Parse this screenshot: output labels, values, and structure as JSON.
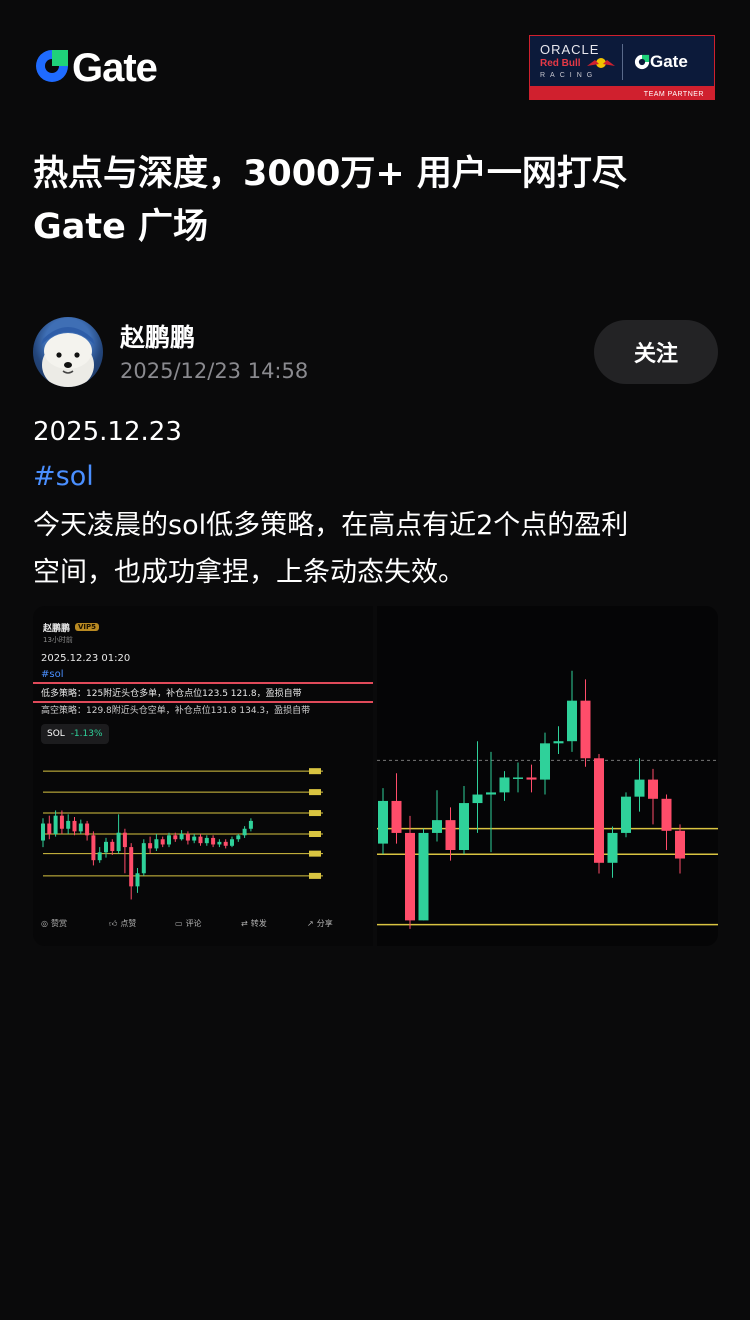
{
  "brand": {
    "name": "Gate",
    "logo_colors": {
      "blue": "#1f6bff",
      "green": "#1fd27a"
    }
  },
  "partner_badge": {
    "line1": "ORACLE",
    "line2": "Red Bull",
    "line3": "RACING",
    "brand": "Gate",
    "footer": "TEAM PARTNER"
  },
  "headline": {
    "line1": "热点与深度，3000万+ 用户一网打尽",
    "line2": "Gate 广场"
  },
  "author": {
    "name": "赵鹏鹏",
    "timestamp": "2025/12/23 14:58",
    "avatar_icon": "dog-avatar-icon"
  },
  "follow_label": "关注",
  "post": {
    "date": "2025.12.23",
    "tag": "#sol",
    "body_line1": "今天凌晨的sol低多策略，在高点有近2个点的盈利",
    "body_line2": "空间，也成功拿捏，上条动态失效。"
  },
  "image1": {
    "name": "赵鹏鹏",
    "vip": "VIP5",
    "ago": "13小时前",
    "date": "2025.12.23 01:20",
    "tag": "#sol",
    "long_line": "低多策略：125附近头仓多单，补仓点位123.5 121.8，盈损自带",
    "short_line": "高空策略：129.8附近头仓空单，补仓点位131.8 134.3，盈损自带",
    "sol_label": "SOL",
    "sol_change": "-1.13%",
    "actions": [
      "赞赏",
      "点赞",
      "评论",
      "转发",
      "分享"
    ]
  },
  "colors": {
    "background": "#0a0a0b",
    "tag_blue": "#4a8fff",
    "candle_up": "#2fd19a",
    "candle_down": "#ff4d6a",
    "level_line": "#d9c441"
  },
  "candles_small": [
    {
      "o": 124.5,
      "c": 125.8,
      "h": 126.2,
      "l": 124.0
    },
    {
      "o": 125.8,
      "c": 125.0,
      "h": 126.4,
      "l": 124.6
    },
    {
      "o": 125.0,
      "c": 126.4,
      "h": 126.8,
      "l": 124.8
    },
    {
      "o": 126.4,
      "c": 125.4,
      "h": 126.8,
      "l": 125.0
    },
    {
      "o": 125.4,
      "c": 126.0,
      "h": 126.5,
      "l": 125.0
    },
    {
      "o": 126.0,
      "c": 125.2,
      "h": 126.3,
      "l": 124.9
    },
    {
      "o": 125.2,
      "c": 125.8,
      "h": 126.1,
      "l": 125.0
    },
    {
      "o": 125.8,
      "c": 124.9,
      "h": 126.0,
      "l": 124.5
    },
    {
      "o": 124.9,
      "c": 123.0,
      "h": 125.2,
      "l": 122.6
    },
    {
      "o": 123.0,
      "c": 123.6,
      "h": 124.0,
      "l": 122.8
    },
    {
      "o": 123.6,
      "c": 124.4,
      "h": 124.7,
      "l": 123.2
    },
    {
      "o": 124.4,
      "c": 123.7,
      "h": 124.6,
      "l": 123.4
    },
    {
      "o": 123.7,
      "c": 125.1,
      "h": 126.5,
      "l": 123.5
    },
    {
      "o": 125.1,
      "c": 124.0,
      "h": 125.4,
      "l": 122.0
    },
    {
      "o": 124.0,
      "c": 121.0,
      "h": 124.3,
      "l": 120.0
    },
    {
      "o": 121.0,
      "c": 122.0,
      "h": 122.4,
      "l": 120.5
    },
    {
      "o": 122.0,
      "c": 124.3,
      "h": 124.6,
      "l": 121.8
    },
    {
      "o": 124.3,
      "c": 123.9,
      "h": 124.8,
      "l": 123.5
    },
    {
      "o": 123.9,
      "c": 124.6,
      "h": 125.0,
      "l": 123.7
    },
    {
      "o": 124.6,
      "c": 124.2,
      "h": 124.8,
      "l": 124.0
    },
    {
      "o": 124.2,
      "c": 124.9,
      "h": 125.1,
      "l": 124.0
    },
    {
      "o": 124.9,
      "c": 124.6,
      "h": 125.1,
      "l": 124.4
    },
    {
      "o": 124.6,
      "c": 125.0,
      "h": 125.3,
      "l": 124.5
    },
    {
      "o": 125.0,
      "c": 124.5,
      "h": 125.2,
      "l": 124.2
    },
    {
      "o": 124.5,
      "c": 124.8,
      "h": 125.0,
      "l": 124.3
    },
    {
      "o": 124.8,
      "c": 124.3,
      "h": 125.0,
      "l": 124.1
    },
    {
      "o": 124.3,
      "c": 124.7,
      "h": 124.9,
      "l": 124.1
    },
    {
      "o": 124.7,
      "c": 124.2,
      "h": 124.9,
      "l": 124.0
    },
    {
      "o": 124.2,
      "c": 124.4,
      "h": 124.6,
      "l": 124.0
    },
    {
      "o": 124.4,
      "c": 124.1,
      "h": 124.6,
      "l": 123.9
    },
    {
      "o": 124.1,
      "c": 124.6,
      "h": 124.8,
      "l": 124.0
    },
    {
      "o": 124.6,
      "c": 124.9,
      "h": 125.0,
      "l": 124.4
    },
    {
      "o": 124.9,
      "c": 125.4,
      "h": 125.6,
      "l": 124.7
    },
    {
      "o": 125.4,
      "c": 126.0,
      "h": 126.2,
      "l": 125.2
    }
  ],
  "levels_small": [
    129.8,
    128.2,
    126.6,
    125.0,
    123.5,
    121.8
  ],
  "candles_large": [
    {
      "o": 123.3,
      "c": 125.3,
      "h": 125.9,
      "l": 122.8
    },
    {
      "o": 125.3,
      "c": 123.8,
      "h": 126.6,
      "l": 123.3
    },
    {
      "o": 123.8,
      "c": 119.7,
      "h": 124.6,
      "l": 119.3
    },
    {
      "o": 119.7,
      "c": 123.8,
      "h": 124.0,
      "l": 119.7
    },
    {
      "o": 123.8,
      "c": 124.4,
      "h": 125.8,
      "l": 123.4
    },
    {
      "o": 124.4,
      "c": 123.0,
      "h": 125.0,
      "l": 122.5
    },
    {
      "o": 123.0,
      "c": 125.2,
      "h": 126.0,
      "l": 122.8
    },
    {
      "o": 125.2,
      "c": 125.6,
      "h": 128.1,
      "l": 123.8
    },
    {
      "o": 125.6,
      "c": 125.7,
      "h": 127.6,
      "l": 122.9
    },
    {
      "o": 125.7,
      "c": 126.4,
      "h": 126.7,
      "l": 125.3
    },
    {
      "o": 126.4,
      "c": 126.4,
      "h": 127.1,
      "l": 125.7
    },
    {
      "o": 126.4,
      "c": 126.3,
      "h": 127.0,
      "l": 125.7
    },
    {
      "o": 126.3,
      "c": 128.0,
      "h": 128.5,
      "l": 125.6
    },
    {
      "o": 128.0,
      "c": 128.1,
      "h": 128.8,
      "l": 127.5
    },
    {
      "o": 128.1,
      "c": 130.0,
      "h": 131.4,
      "l": 127.6
    },
    {
      "o": 130.0,
      "c": 127.3,
      "h": 131.0,
      "l": 126.9
    },
    {
      "o": 127.3,
      "c": 122.4,
      "h": 127.5,
      "l": 121.9
    },
    {
      "o": 122.4,
      "c": 123.8,
      "h": 124.1,
      "l": 121.7
    },
    {
      "o": 123.8,
      "c": 125.5,
      "h": 125.7,
      "l": 123.6
    },
    {
      "o": 125.5,
      "c": 126.3,
      "h": 127.3,
      "l": 124.8
    },
    {
      "o": 126.3,
      "c": 125.4,
      "h": 126.8,
      "l": 124.2
    },
    {
      "o": 125.4,
      "c": 123.9,
      "h": 125.6,
      "l": 123.0
    },
    {
      "o": 123.9,
      "c": 122.6,
      "h": 124.2,
      "l": 121.9
    }
  ],
  "levels_large": [
    124.0,
    122.8,
    119.5
  ],
  "dashed_level_large": 127.2
}
